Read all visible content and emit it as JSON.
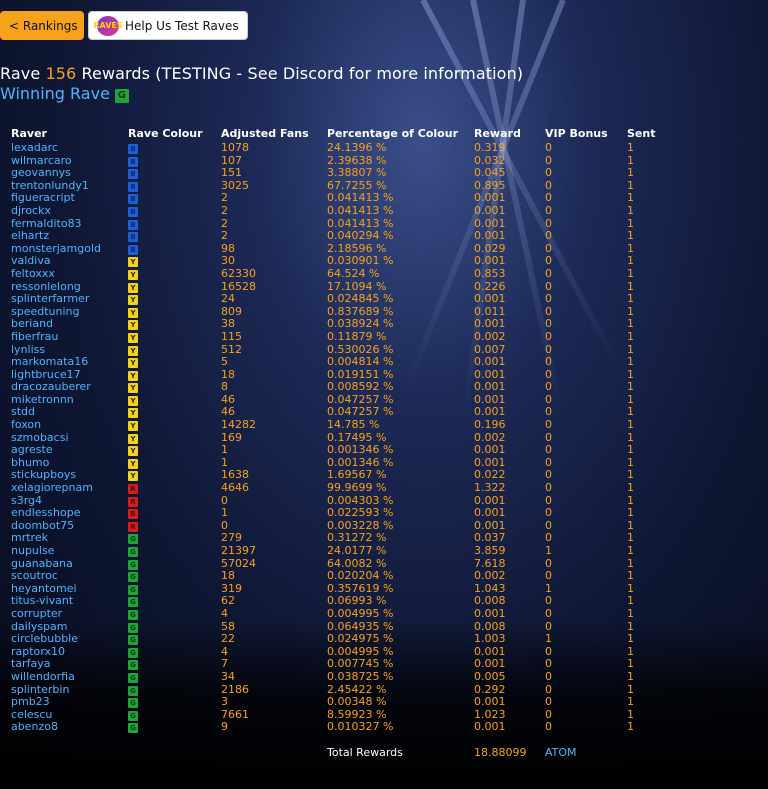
{
  "nav": {
    "rankings_label": "< Rankings",
    "help_label": "Help Us Test Raves",
    "help_logo_icon": "raves-logo"
  },
  "header": {
    "title_prefix": "Rave ",
    "rave_number": "156",
    "title_suffix": " Rewards (TESTING - See Discord for more information)",
    "winning_label": "Winning Rave",
    "winning_colour": "G"
  },
  "colours": {
    "accent_orange": "#f7a21b",
    "link_blue": "#4fb3ff",
    "B": "#1f5fd1",
    "Y": "#f4d21c",
    "R": "#d11f1f",
    "G": "#1fa33a"
  },
  "table": {
    "columns": [
      "Raver",
      "Rave Colour",
      "Adjusted Fans",
      "Percentage of Colour",
      "Reward",
      "VIP Bonus",
      "Sent"
    ],
    "rows": [
      {
        "raver": "lexadarc",
        "colour": "B",
        "fans": "1078",
        "pct": "24.1396 %",
        "reward": "0.319",
        "vip": "0",
        "sent": "1"
      },
      {
        "raver": "wilmarcaro",
        "colour": "B",
        "fans": "107",
        "pct": "2.39638 %",
        "reward": "0.032",
        "vip": "0",
        "sent": "1"
      },
      {
        "raver": "geovannys",
        "colour": "B",
        "fans": "151",
        "pct": "3.38807 %",
        "reward": "0.045",
        "vip": "0",
        "sent": "1"
      },
      {
        "raver": "trentonlundy1",
        "colour": "B",
        "fans": "3025",
        "pct": "67.7255 %",
        "reward": "0.895",
        "vip": "0",
        "sent": "1"
      },
      {
        "raver": "figueracript",
        "colour": "B",
        "fans": "2",
        "pct": "0.041413 %",
        "reward": "0.001",
        "vip": "0",
        "sent": "1"
      },
      {
        "raver": "djrockx",
        "colour": "B",
        "fans": "2",
        "pct": "0.041413 %",
        "reward": "0.001",
        "vip": "0",
        "sent": "1"
      },
      {
        "raver": "fermaldito83",
        "colour": "B",
        "fans": "2",
        "pct": "0.041413 %",
        "reward": "0.001",
        "vip": "0",
        "sent": "1"
      },
      {
        "raver": "elhartz",
        "colour": "B",
        "fans": "2",
        "pct": "0.040294 %",
        "reward": "0.001",
        "vip": "0",
        "sent": "1"
      },
      {
        "raver": "monsterjamgold",
        "colour": "B",
        "fans": "98",
        "pct": "2.18596 %",
        "reward": "0.029",
        "vip": "0",
        "sent": "1"
      },
      {
        "raver": "valdiva",
        "colour": "Y",
        "fans": "30",
        "pct": "0.030901 %",
        "reward": "0.001",
        "vip": "0",
        "sent": "1"
      },
      {
        "raver": "feltoxxx",
        "colour": "Y",
        "fans": "62330",
        "pct": "64.524 %",
        "reward": "0.853",
        "vip": "0",
        "sent": "1"
      },
      {
        "raver": "ressonlelong",
        "colour": "Y",
        "fans": "16528",
        "pct": "17.1094 %",
        "reward": "0.226",
        "vip": "0",
        "sent": "1"
      },
      {
        "raver": "splinterfarmer",
        "colour": "Y",
        "fans": "24",
        "pct": "0.024845 %",
        "reward": "0.001",
        "vip": "0",
        "sent": "1"
      },
      {
        "raver": "speedtuning",
        "colour": "Y",
        "fans": "809",
        "pct": "0.837689 %",
        "reward": "0.011",
        "vip": "0",
        "sent": "1"
      },
      {
        "raver": "beriand",
        "colour": "Y",
        "fans": "38",
        "pct": "0.038924 %",
        "reward": "0.001",
        "vip": "0",
        "sent": "1"
      },
      {
        "raver": "fiberfrau",
        "colour": "Y",
        "fans": "115",
        "pct": "0.11879 %",
        "reward": "0.002",
        "vip": "0",
        "sent": "1"
      },
      {
        "raver": "lynliss",
        "colour": "Y",
        "fans": "512",
        "pct": "0.530026 %",
        "reward": "0.007",
        "vip": "0",
        "sent": "1"
      },
      {
        "raver": "markomata16",
        "colour": "Y",
        "fans": "5",
        "pct": "0.004814 %",
        "reward": "0.001",
        "vip": "0",
        "sent": "1"
      },
      {
        "raver": "lightbruce17",
        "colour": "Y",
        "fans": "18",
        "pct": "0.019151 %",
        "reward": "0.001",
        "vip": "0",
        "sent": "1"
      },
      {
        "raver": "dracozauberer",
        "colour": "Y",
        "fans": "8",
        "pct": "0.008592 %",
        "reward": "0.001",
        "vip": "0",
        "sent": "1"
      },
      {
        "raver": "miketronnn",
        "colour": "Y",
        "fans": "46",
        "pct": "0.047257 %",
        "reward": "0.001",
        "vip": "0",
        "sent": "1"
      },
      {
        "raver": "stdd",
        "colour": "Y",
        "fans": "46",
        "pct": "0.047257 %",
        "reward": "0.001",
        "vip": "0",
        "sent": "1"
      },
      {
        "raver": "foxon",
        "colour": "Y",
        "fans": "14282",
        "pct": "14.785 %",
        "reward": "0.196",
        "vip": "0",
        "sent": "1"
      },
      {
        "raver": "szmobacsi",
        "colour": "Y",
        "fans": "169",
        "pct": "0.17495 %",
        "reward": "0.002",
        "vip": "0",
        "sent": "1"
      },
      {
        "raver": "agreste",
        "colour": "Y",
        "fans": "1",
        "pct": "0.001346 %",
        "reward": "0.001",
        "vip": "0",
        "sent": "1"
      },
      {
        "raver": "bhumo",
        "colour": "Y",
        "fans": "1",
        "pct": "0.001346 %",
        "reward": "0.001",
        "vip": "0",
        "sent": "1"
      },
      {
        "raver": "stickupboys",
        "colour": "Y",
        "fans": "1638",
        "pct": "1.69567 %",
        "reward": "0.022",
        "vip": "0",
        "sent": "1"
      },
      {
        "raver": "xelagiorepnam",
        "colour": "R",
        "fans": "4646",
        "pct": "99.9699 %",
        "reward": "1.322",
        "vip": "0",
        "sent": "1"
      },
      {
        "raver": "s3rg4",
        "colour": "R",
        "fans": "0",
        "pct": "0.004303 %",
        "reward": "0.001",
        "vip": "0",
        "sent": "1"
      },
      {
        "raver": "endlesshope",
        "colour": "R",
        "fans": "1",
        "pct": "0.022593 %",
        "reward": "0.001",
        "vip": "0",
        "sent": "1"
      },
      {
        "raver": "doombot75",
        "colour": "R",
        "fans": "0",
        "pct": "0.003228 %",
        "reward": "0.001",
        "vip": "0",
        "sent": "1"
      },
      {
        "raver": "mrtrek",
        "colour": "G",
        "fans": "279",
        "pct": "0.31272 %",
        "reward": "0.037",
        "vip": "0",
        "sent": "1"
      },
      {
        "raver": "nupulse",
        "colour": "G",
        "fans": "21397",
        "pct": "24.0177 %",
        "reward": "3.859",
        "vip": "1",
        "sent": "1"
      },
      {
        "raver": "guanabana",
        "colour": "G",
        "fans": "57024",
        "pct": "64.0082 %",
        "reward": "7.618",
        "vip": "0",
        "sent": "1"
      },
      {
        "raver": "scoutroc",
        "colour": "G",
        "fans": "18",
        "pct": "0.020204 %",
        "reward": "0.002",
        "vip": "0",
        "sent": "1"
      },
      {
        "raver": "heyantomei",
        "colour": "G",
        "fans": "319",
        "pct": "0.357619 %",
        "reward": "1.043",
        "vip": "1",
        "sent": "1"
      },
      {
        "raver": "titus-vivant",
        "colour": "G",
        "fans": "62",
        "pct": "0.06993 %",
        "reward": "0.008",
        "vip": "0",
        "sent": "1"
      },
      {
        "raver": "corrupter",
        "colour": "G",
        "fans": "4",
        "pct": "0.004995 %",
        "reward": "0.001",
        "vip": "0",
        "sent": "1"
      },
      {
        "raver": "dailyspam",
        "colour": "G",
        "fans": "58",
        "pct": "0.064935 %",
        "reward": "0.008",
        "vip": "0",
        "sent": "1"
      },
      {
        "raver": "circlebubble",
        "colour": "G",
        "fans": "22",
        "pct": "0.024975 %",
        "reward": "1.003",
        "vip": "1",
        "sent": "1"
      },
      {
        "raver": "raptorx10",
        "colour": "G",
        "fans": "4",
        "pct": "0.004995 %",
        "reward": "0.001",
        "vip": "0",
        "sent": "1"
      },
      {
        "raver": "tarfaya",
        "colour": "G",
        "fans": "7",
        "pct": "0.007745 %",
        "reward": "0.001",
        "vip": "0",
        "sent": "1"
      },
      {
        "raver": "willendorfia",
        "colour": "G",
        "fans": "34",
        "pct": "0.038725 %",
        "reward": "0.005",
        "vip": "0",
        "sent": "1"
      },
      {
        "raver": "splinterbin",
        "colour": "G",
        "fans": "2186",
        "pct": "2.45422 %",
        "reward": "0.292",
        "vip": "0",
        "sent": "1"
      },
      {
        "raver": "pmb23",
        "colour": "G",
        "fans": "3",
        "pct": "0.00348 %",
        "reward": "0.001",
        "vip": "0",
        "sent": "1"
      },
      {
        "raver": "celescu",
        "colour": "G",
        "fans": "7661",
        "pct": "8.59923 %",
        "reward": "1.023",
        "vip": "0",
        "sent": "1"
      },
      {
        "raver": "abenzo8",
        "colour": "G",
        "fans": "9",
        "pct": "0.010327 %",
        "reward": "0.001",
        "vip": "0",
        "sent": "1"
      }
    ],
    "total_label": "Total Rewards",
    "total_value": "18.88099",
    "total_unit": "ATOM"
  }
}
